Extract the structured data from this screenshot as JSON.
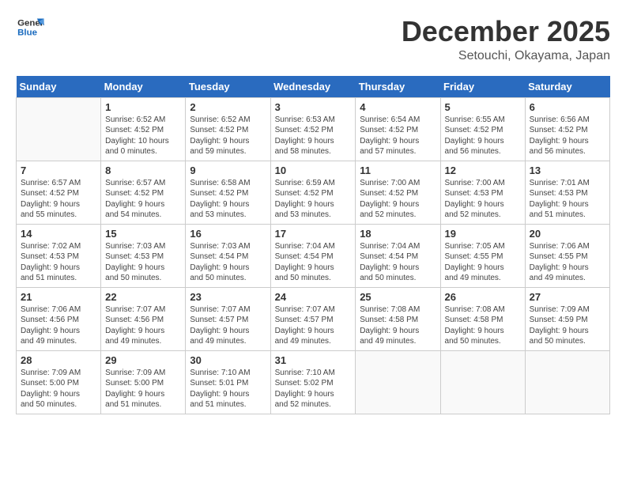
{
  "logo": {
    "line1": "General",
    "line2": "Blue"
  },
  "title": "December 2025",
  "location": "Setouchi, Okayama, Japan",
  "weekdays": [
    "Sunday",
    "Monday",
    "Tuesday",
    "Wednesday",
    "Thursday",
    "Friday",
    "Saturday"
  ],
  "weeks": [
    [
      {
        "day": "",
        "info": ""
      },
      {
        "day": "1",
        "info": "Sunrise: 6:52 AM\nSunset: 4:52 PM\nDaylight: 10 hours\nand 0 minutes."
      },
      {
        "day": "2",
        "info": "Sunrise: 6:52 AM\nSunset: 4:52 PM\nDaylight: 9 hours\nand 59 minutes."
      },
      {
        "day": "3",
        "info": "Sunrise: 6:53 AM\nSunset: 4:52 PM\nDaylight: 9 hours\nand 58 minutes."
      },
      {
        "day": "4",
        "info": "Sunrise: 6:54 AM\nSunset: 4:52 PM\nDaylight: 9 hours\nand 57 minutes."
      },
      {
        "day": "5",
        "info": "Sunrise: 6:55 AM\nSunset: 4:52 PM\nDaylight: 9 hours\nand 56 minutes."
      },
      {
        "day": "6",
        "info": "Sunrise: 6:56 AM\nSunset: 4:52 PM\nDaylight: 9 hours\nand 56 minutes."
      }
    ],
    [
      {
        "day": "7",
        "info": "Sunrise: 6:57 AM\nSunset: 4:52 PM\nDaylight: 9 hours\nand 55 minutes."
      },
      {
        "day": "8",
        "info": "Sunrise: 6:57 AM\nSunset: 4:52 PM\nDaylight: 9 hours\nand 54 minutes."
      },
      {
        "day": "9",
        "info": "Sunrise: 6:58 AM\nSunset: 4:52 PM\nDaylight: 9 hours\nand 53 minutes."
      },
      {
        "day": "10",
        "info": "Sunrise: 6:59 AM\nSunset: 4:52 PM\nDaylight: 9 hours\nand 53 minutes."
      },
      {
        "day": "11",
        "info": "Sunrise: 7:00 AM\nSunset: 4:52 PM\nDaylight: 9 hours\nand 52 minutes."
      },
      {
        "day": "12",
        "info": "Sunrise: 7:00 AM\nSunset: 4:53 PM\nDaylight: 9 hours\nand 52 minutes."
      },
      {
        "day": "13",
        "info": "Sunrise: 7:01 AM\nSunset: 4:53 PM\nDaylight: 9 hours\nand 51 minutes."
      }
    ],
    [
      {
        "day": "14",
        "info": "Sunrise: 7:02 AM\nSunset: 4:53 PM\nDaylight: 9 hours\nand 51 minutes."
      },
      {
        "day": "15",
        "info": "Sunrise: 7:03 AM\nSunset: 4:53 PM\nDaylight: 9 hours\nand 50 minutes."
      },
      {
        "day": "16",
        "info": "Sunrise: 7:03 AM\nSunset: 4:54 PM\nDaylight: 9 hours\nand 50 minutes."
      },
      {
        "day": "17",
        "info": "Sunrise: 7:04 AM\nSunset: 4:54 PM\nDaylight: 9 hours\nand 50 minutes."
      },
      {
        "day": "18",
        "info": "Sunrise: 7:04 AM\nSunset: 4:54 PM\nDaylight: 9 hours\nand 50 minutes."
      },
      {
        "day": "19",
        "info": "Sunrise: 7:05 AM\nSunset: 4:55 PM\nDaylight: 9 hours\nand 49 minutes."
      },
      {
        "day": "20",
        "info": "Sunrise: 7:06 AM\nSunset: 4:55 PM\nDaylight: 9 hours\nand 49 minutes."
      }
    ],
    [
      {
        "day": "21",
        "info": "Sunrise: 7:06 AM\nSunset: 4:56 PM\nDaylight: 9 hours\nand 49 minutes."
      },
      {
        "day": "22",
        "info": "Sunrise: 7:07 AM\nSunset: 4:56 PM\nDaylight: 9 hours\nand 49 minutes."
      },
      {
        "day": "23",
        "info": "Sunrise: 7:07 AM\nSunset: 4:57 PM\nDaylight: 9 hours\nand 49 minutes."
      },
      {
        "day": "24",
        "info": "Sunrise: 7:07 AM\nSunset: 4:57 PM\nDaylight: 9 hours\nand 49 minutes."
      },
      {
        "day": "25",
        "info": "Sunrise: 7:08 AM\nSunset: 4:58 PM\nDaylight: 9 hours\nand 49 minutes."
      },
      {
        "day": "26",
        "info": "Sunrise: 7:08 AM\nSunset: 4:58 PM\nDaylight: 9 hours\nand 50 minutes."
      },
      {
        "day": "27",
        "info": "Sunrise: 7:09 AM\nSunset: 4:59 PM\nDaylight: 9 hours\nand 50 minutes."
      }
    ],
    [
      {
        "day": "28",
        "info": "Sunrise: 7:09 AM\nSunset: 5:00 PM\nDaylight: 9 hours\nand 50 minutes."
      },
      {
        "day": "29",
        "info": "Sunrise: 7:09 AM\nSunset: 5:00 PM\nDaylight: 9 hours\nand 51 minutes."
      },
      {
        "day": "30",
        "info": "Sunrise: 7:10 AM\nSunset: 5:01 PM\nDaylight: 9 hours\nand 51 minutes."
      },
      {
        "day": "31",
        "info": "Sunrise: 7:10 AM\nSunset: 5:02 PM\nDaylight: 9 hours\nand 52 minutes."
      },
      {
        "day": "",
        "info": ""
      },
      {
        "day": "",
        "info": ""
      },
      {
        "day": "",
        "info": ""
      }
    ]
  ]
}
